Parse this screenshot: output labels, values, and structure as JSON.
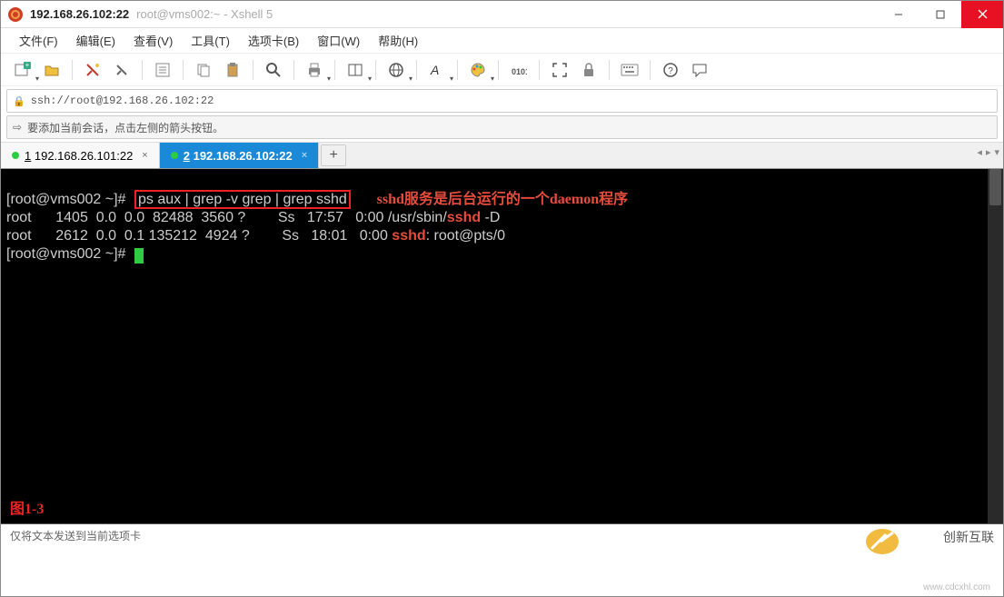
{
  "window": {
    "title": "192.168.26.102:22",
    "subtitle": "root@vms002:~ - Xshell 5"
  },
  "menu": {
    "file": "文件(F)",
    "edit": "编辑(E)",
    "view": "查看(V)",
    "tools": "工具(T)",
    "tabs": "选项卡(B)",
    "window": "窗口(W)",
    "help": "帮助(H)"
  },
  "addressbar": {
    "url": "ssh://root@192.168.26.102:22"
  },
  "hint": {
    "text": "要添加当前会话，点击左侧的箭头按钮。"
  },
  "tabs": {
    "tab1": {
      "index": "1",
      "label": "192.168.26.101:22"
    },
    "tab2": {
      "index": "2",
      "label": "192.168.26.102:22"
    },
    "add": "+"
  },
  "terminal": {
    "prompt1": "[root@vms002 ~]#",
    "command": "ps aux | grep -v grep | grep sshd",
    "annotation": "sshd服务是后台运行的一个daemon程序",
    "row1_a": "root      1405  0.0  0.0  82488  3560 ?        Ss   17:57   0:00 /usr/sbin/",
    "row1_hw": "sshd",
    "row1_b": " -D",
    "row2_a": "root      2612  0.0  0.1 135212  4924 ?        Ss   18:01   0:00 ",
    "row2_hw": "sshd",
    "row2_b": ": root@pts/0",
    "prompt2": "[root@vms002 ~]#",
    "figlabel": "图1-3"
  },
  "status": {
    "text": "仅将文本发送到当前选项卡",
    "brand1": "创新互联",
    "brand2": "www.cdcxhl.com"
  }
}
